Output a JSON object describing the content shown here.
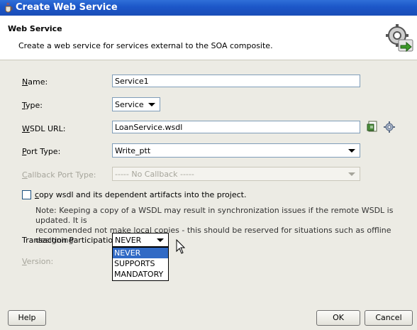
{
  "window": {
    "title": "Create Web Service"
  },
  "header": {
    "title": "Web Service",
    "description": "Create a web service for services external to the SOA composite."
  },
  "form": {
    "name": {
      "label": "Name:",
      "mnemonic": "N",
      "rest": "ame:",
      "value": "Service1"
    },
    "type": {
      "label": "Type:",
      "mnemonic": "T",
      "rest": "ype:",
      "value": "Service"
    },
    "wsdl": {
      "label": "WSDL URL:",
      "mnemonic": "W",
      "rest": "SDL URL:",
      "value": "LoanService.wsdl"
    },
    "port_type": {
      "label": "Port Type:",
      "mnemonic": "P",
      "rest": "ort Type:",
      "value": "Write_ptt"
    },
    "callback": {
      "label": "Callback Port Type:",
      "mnemonic": "C",
      "rest": "allback Port Type:",
      "value": "----- No Callback -----"
    },
    "copy_wsdl": {
      "label": "copy wsdl and its dependent artifacts into the project.",
      "mnemonic": "c",
      "rest": "opy wsdl and its dependent artifacts into the project.",
      "checked": false
    },
    "note_line1": "Note: Keeping a copy of a WSDL may result in synchronization issues if the remote WSDL is updated. It is",
    "note_line2": "recommended not make local copies - this should be reserved for situations such as offline designing.",
    "transaction": {
      "label": "Transaction Participation:",
      "value": "NEVER",
      "options": [
        "NEVER",
        "SUPPORTS",
        "MANDATORY"
      ],
      "selected_index": 0
    },
    "version": {
      "label": "Version:",
      "mnemonic": "V",
      "rest": "ersion:"
    }
  },
  "buttons": {
    "help": "Help",
    "ok": "OK",
    "cancel": "Cancel"
  },
  "icons": {
    "title": "java-cup-icon",
    "header": "gear-service-icon",
    "browse": "browse-wsdl-icon",
    "generate": "gear-icon"
  }
}
